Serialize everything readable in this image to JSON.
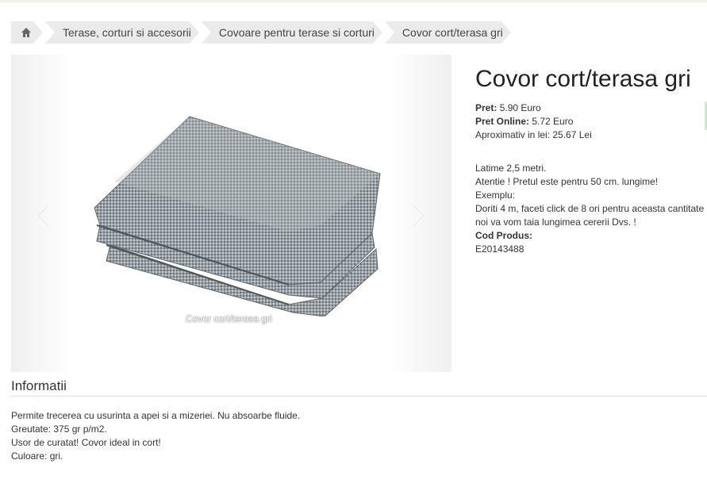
{
  "breadcrumb": {
    "items": [
      "Terase, corturi si accesorii",
      "Covoare pentru terase si corturi",
      "Covor cort/terasa gri"
    ]
  },
  "gallery": {
    "watermark": "Covor cort/terasa gri"
  },
  "product": {
    "title": "Covor cort/terasa gri",
    "price_label": "Pret:",
    "price_value": "5.90 Euro",
    "online_label": "Pret Online:",
    "online_value": "5.72 Euro",
    "approx": "Aproximativ in lei: 25.67 Lei",
    "desc1": "Latime 2,5 metri.",
    "desc2": "Atentie ! Pretul este pentru 50 cm. lungime!",
    "desc3": "Exemplu:",
    "desc4": "Doriti 4 m, faceti click de 8 ori pentru aceasta cantitate",
    "desc5": "noi va vom taia lungimea cererii Dvs. !",
    "code_label": "Cod Produs:",
    "code_value": "E20143488"
  },
  "info": {
    "heading": "Informatii",
    "line1": "Permite trecerea cu usurinta a apei si a mizeriei. Nu absoarbe fluide.",
    "line2": "Greutate: 375 gr p/m2.",
    "line3": "Usor de curatat! Covor ideal in cort!",
    "line4": "Culoare: gri."
  }
}
